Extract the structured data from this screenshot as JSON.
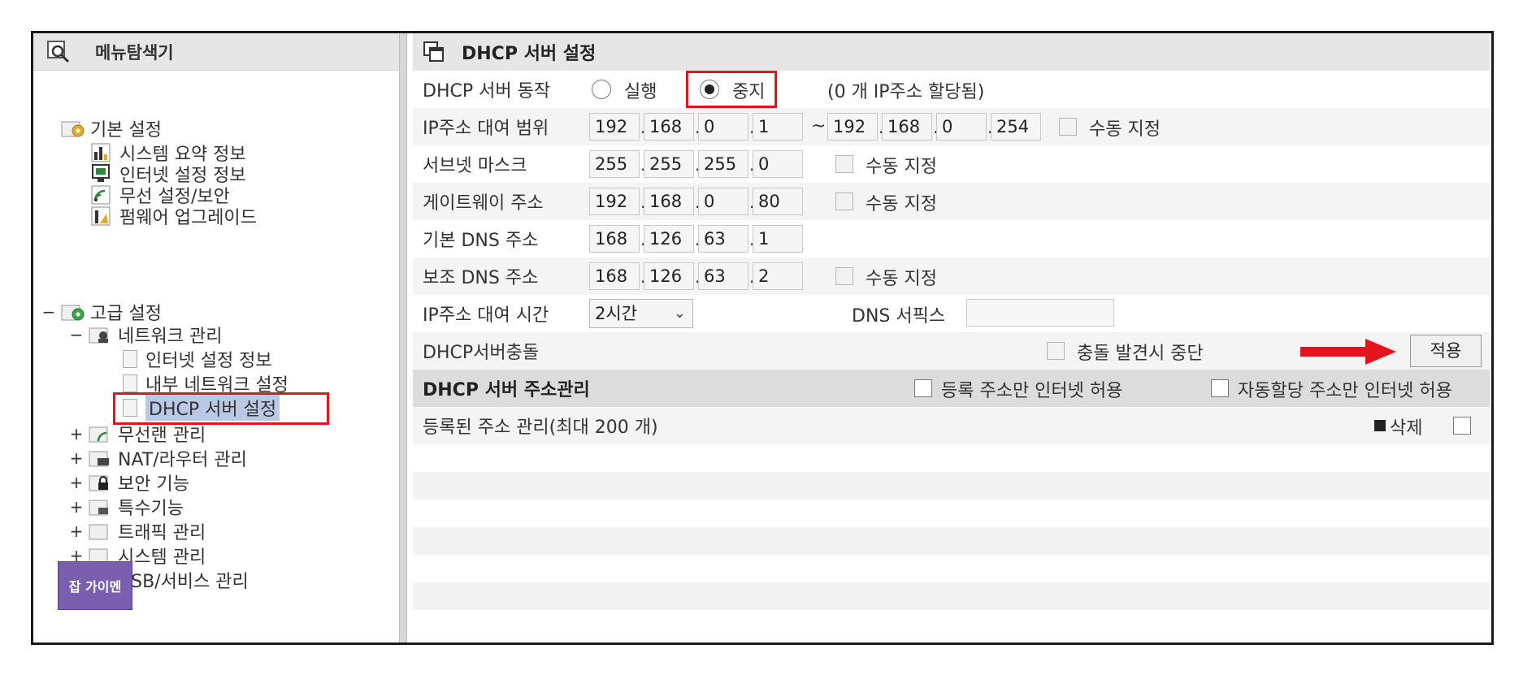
{
  "sidebar": {
    "header": "메뉴탐색기",
    "basic": {
      "label": "기본 설정",
      "items": [
        "시스템 요약 정보",
        "인터넷 설정 정보",
        "무선 설정/보안",
        "펌웨어 업그레이드"
      ]
    },
    "advanced": {
      "toggle": "−",
      "label": "고급 설정",
      "network": {
        "toggle": "−",
        "label": "네트워크 관리",
        "items": [
          "인터넷 설정 정보",
          "내부 네트워크 설정",
          "DHCP 서버 설정"
        ]
      },
      "others": [
        {
          "toggle": "+",
          "label": "무선랜 관리"
        },
        {
          "toggle": "+",
          "label": "NAT/라우터 관리"
        },
        {
          "toggle": "+",
          "label": "보안 기능"
        },
        {
          "toggle": "+",
          "label": "특수기능"
        },
        {
          "toggle": "+",
          "label": "트래픽 관리"
        },
        {
          "toggle": "+",
          "label": "시스템 관리"
        },
        {
          "toggle": "+",
          "label": "USB/서비스 관리"
        }
      ]
    },
    "watermark": {
      "top": "",
      "main": "잡 가이멘",
      "bottom": ""
    }
  },
  "main": {
    "title": "DHCP 서버 설정",
    "operation": {
      "label": "DHCP 서버 동작",
      "run": "실행",
      "stop": "중지",
      "selected": "stop",
      "status": "(0 개 IP주소 할당됨)"
    },
    "lease_range": {
      "label": "IP주소 대여 범위",
      "start": [
        "192",
        "168",
        "0",
        "1"
      ],
      "sep": "~",
      "end": [
        "192",
        "168",
        "0",
        "254"
      ],
      "manual": "수동 지정"
    },
    "subnet": {
      "label": "서브넷 마스크",
      "ip": [
        "255",
        "255",
        "255",
        "0"
      ],
      "manual": "수동 지정"
    },
    "gateway": {
      "label": "게이트웨이 주소",
      "ip": [
        "192",
        "168",
        "0",
        "80"
      ],
      "manual": "수동 지정"
    },
    "dns1": {
      "label": "기본 DNS 주소",
      "ip": [
        "168",
        "126",
        "63",
        "1"
      ]
    },
    "dns2": {
      "label": "보조 DNS 주소",
      "ip": [
        "168",
        "126",
        "63",
        "2"
      ],
      "manual": "수동 지정"
    },
    "lease_time": {
      "label": "IP주소 대여 시간",
      "value": "2시간",
      "dns_suffix_label": "DNS 서픽스",
      "dns_suffix_value": ""
    },
    "conflict": {
      "label": "DHCP서버충돌",
      "stop_label": "충돌 발견시 중단",
      "apply": "적용"
    },
    "addr_mgmt": {
      "title": "DHCP 서버 주소관리",
      "opt1": "등록 주소만 인터넷 허용",
      "opt2": "자동할당 주소만 인터넷 허용"
    },
    "registered": {
      "label": "등록된 주소 관리(최대 200 개)",
      "delete": "삭제"
    }
  },
  "colors": {
    "highlight_box": "#e3141b",
    "arrow": "#e3141b",
    "selected_bg": "#b9c9e3",
    "header_bg": "#e6e6e6"
  }
}
